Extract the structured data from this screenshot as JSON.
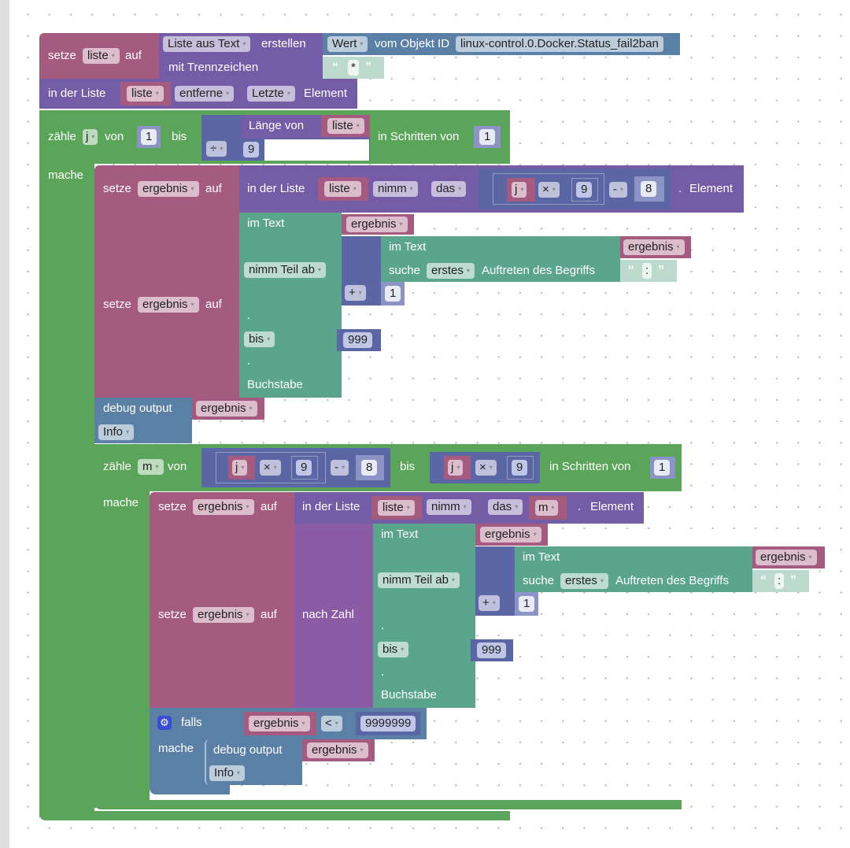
{
  "block1": {
    "setze": "setze",
    "var": "liste",
    "auf": "auf",
    "list_from_text": "Liste aus Text",
    "erstellen": "erstellen",
    "wert": "Wert",
    "vom_objekt_id": "vom Objekt ID",
    "object_id": "linux-control.0.Docker.Status_fail2ban",
    "mit_trennzeichen": "mit Trennzeichen",
    "delimiter": "*"
  },
  "block2": {
    "in_der_liste": "in der Liste",
    "var": "liste",
    "op": "entferne",
    "pos": "Letzte",
    "element": "Element"
  },
  "loop_j": {
    "zaehle": "zähle",
    "var": "j",
    "von": "von",
    "from": "1",
    "bis": "bis",
    "laenge_von": "Länge von",
    "len_var": "liste",
    "div_op": "÷",
    "divisor": "9",
    "in_schritten_von": "in Schritten von",
    "step": "1",
    "mache": "mache"
  },
  "set1": {
    "setze": "setze",
    "var": "ergebnis",
    "auf": "auf",
    "in_der_liste": "in der Liste",
    "list_var": "liste",
    "nimm": "nimm",
    "das": "das",
    "j": "j",
    "mul": "×",
    "nine": "9",
    "minus": "-",
    "eight": "8",
    "dot": ".",
    "element": "Element"
  },
  "set2": {
    "setze": "setze",
    "var": "ergebnis",
    "auf": "auf",
    "im_text": "im Text",
    "text_var": "ergebnis",
    "nimm_teil_ab": "nimm Teil ab",
    "inner_im_text": "im Text",
    "inner_var": "ergebnis",
    "suche": "suche",
    "erstes": "erstes",
    "auftreten": "Auftreten des Begriffs",
    "search": ":",
    "plus": "+",
    "one": "1",
    "dot1": ".",
    "bis": "bis",
    "to": "999",
    "dot2": ".",
    "buchstabe": "Buchstabe"
  },
  "debug1": {
    "label": "debug output",
    "var": "ergebnis",
    "level": "Info"
  },
  "loop_m": {
    "zaehle": "zähle",
    "var": "m",
    "von": "von",
    "j": "j",
    "mul": "×",
    "nine": "9",
    "minus": "-",
    "eight": "8",
    "bis": "bis",
    "j2": "j",
    "mul2": "×",
    "nine2": "9",
    "in_schritten_von": "in Schritten von",
    "step": "1",
    "mache": "mache"
  },
  "set3": {
    "setze": "setze",
    "var": "ergebnis",
    "auf": "auf",
    "in_der_liste": "in der Liste",
    "list_var": "liste",
    "nimm": "nimm",
    "das": "das",
    "idx": "m",
    "dot": ".",
    "element": "Element"
  },
  "set4": {
    "setze": "setze",
    "var": "ergebnis",
    "auf": "auf",
    "nach_zahl": "nach Zahl",
    "im_text": "im Text",
    "text_var": "ergebnis",
    "nimm_teil_ab": "nimm Teil ab",
    "inner_im_text": "im Text",
    "inner_var": "ergebnis",
    "suche": "suche",
    "erstes": "erstes",
    "auftreten": "Auftreten des Begriffs",
    "search": ":",
    "plus": "+",
    "one": "1",
    "dot1": ".",
    "bis": "bis",
    "to": "999",
    "dot2": ".",
    "buchstabe": "Buchstabe"
  },
  "if1": {
    "falls": "falls",
    "var": "ergebnis",
    "op": "<",
    "value": "9999999",
    "mache": "mache",
    "debug_label": "debug output",
    "debug_var": "ergebnis",
    "debug_level": "Info"
  },
  "dropdown_arrow": "▾",
  "quote_open": "“",
  "quote_close": "”",
  "gear_glyph": "⚙"
}
